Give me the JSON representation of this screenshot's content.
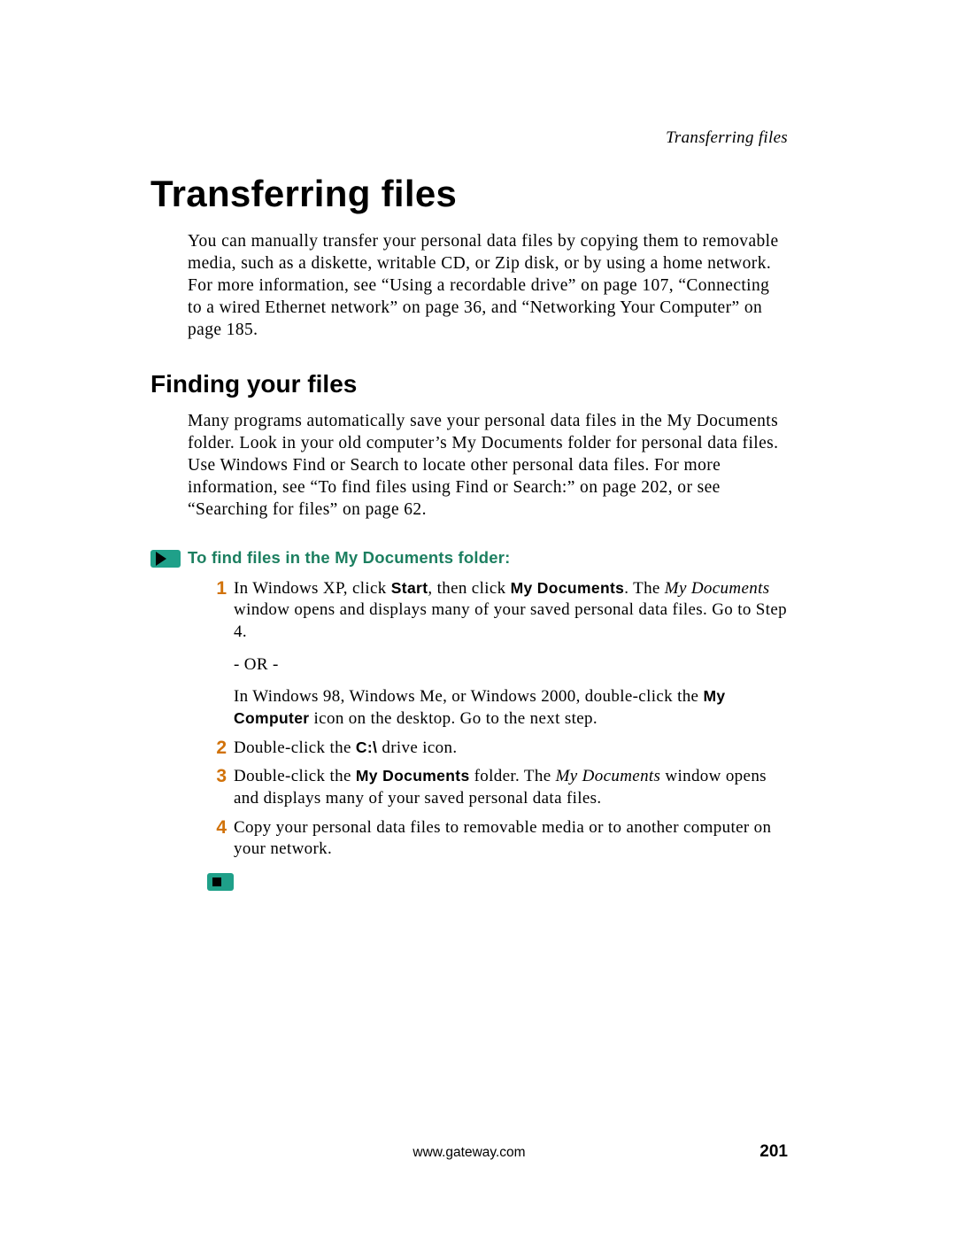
{
  "running_head": "Transferring files",
  "title": "Transferring files",
  "intro": "You can manually transfer your personal data files by copying them to removable media, such as a diskette, writable CD, or Zip disk, or by using a home network. For more information, see “Using a recordable drive” on page 107, “Connecting to a wired Ethernet network” on page 36, and “Networking Your Computer” on page 185.",
  "subtitle": "Finding your files",
  "sub_intro": "Many programs automatically save your personal data files in the My Documents folder. Look in your old computer’s My Documents folder for personal data files. Use Windows Find or Search to locate other personal data files. For more information, see “To find files using Find or Search:” on page 202, or see “Searching for files” on page 62.",
  "procedure_title": "To find files in the My Documents folder:",
  "steps": {
    "s1": {
      "num": "1",
      "p1_a": "In Windows XP, click ",
      "p1_b": "Start",
      "p1_c": ", then click ",
      "p1_d": "My Documents",
      "p1_e": ". The ",
      "p1_f": "My Documents",
      "p1_g": " window opens and displays many of your saved personal data files. Go to Step 4.",
      "or": "- OR -",
      "p2_a": "In Windows 98, Windows Me, or Windows 2000, double-click the ",
      "p2_b": "My Computer",
      "p2_c": " icon on the desktop. Go to the next step."
    },
    "s2": {
      "num": "2",
      "a": "Double-click the ",
      "b": "C:\\",
      "c": " drive icon."
    },
    "s3": {
      "num": "3",
      "a": "Double-click the ",
      "b": "My Documents",
      "c": " folder. The ",
      "d": "My Documents",
      "e": " window opens and displays many of your saved personal data files."
    },
    "s4": {
      "num": "4",
      "a": "Copy your personal data files to removable media or to another computer on your network."
    }
  },
  "footer": {
    "url": "www.gateway.com",
    "page": "201"
  }
}
